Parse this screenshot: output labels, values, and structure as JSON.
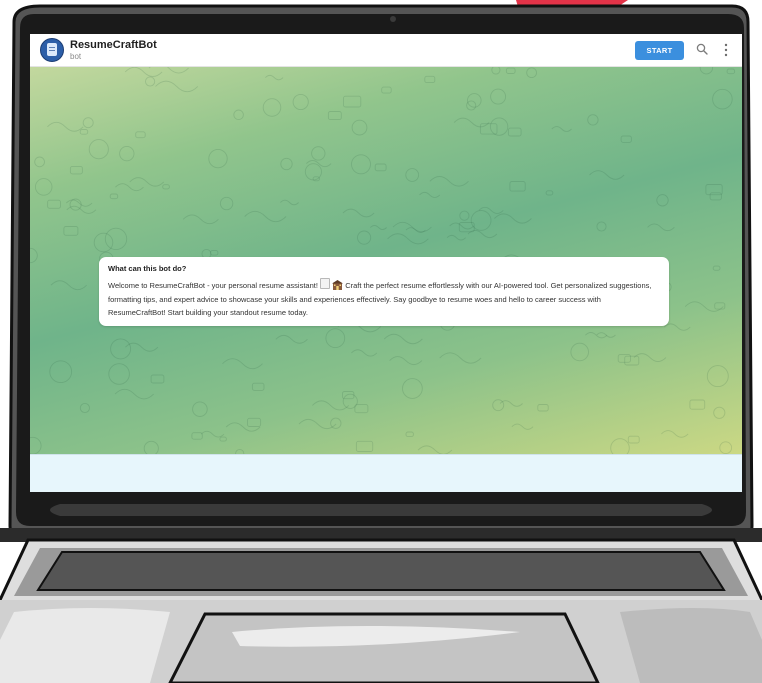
{
  "header": {
    "bot_name": "ResumeCraftBot",
    "bot_subtitle": "bot",
    "start_label": "START",
    "avatar_icon": "resume-document-icon",
    "search_icon": "search-icon",
    "menu_icon": "kebab-menu-icon"
  },
  "message": {
    "title": "What can this bot do?",
    "body_part1": "Welcome to ResumeCraftBot - your personal resume assistant! ",
    "body_part2": " Craft the perfect resume effortlessly with our AI-powered tool. Get personalized suggestions, formatting tips, and expert advice to showcase your skills and experiences effectively. Say goodbye to resume woes and hello to career success with ResumeCraftBot! Start building your standout resume today.",
    "emoji_1": "page-facing-up-icon",
    "emoji_2": "office-building-icon"
  },
  "colors": {
    "accent": "#3b8fde",
    "laptop_body": "#555555",
    "bezel": "#1a1a1a",
    "decor_red": "#e33348",
    "chat_green": "#7fbd8a",
    "chat_yellow": "#cbd884"
  }
}
